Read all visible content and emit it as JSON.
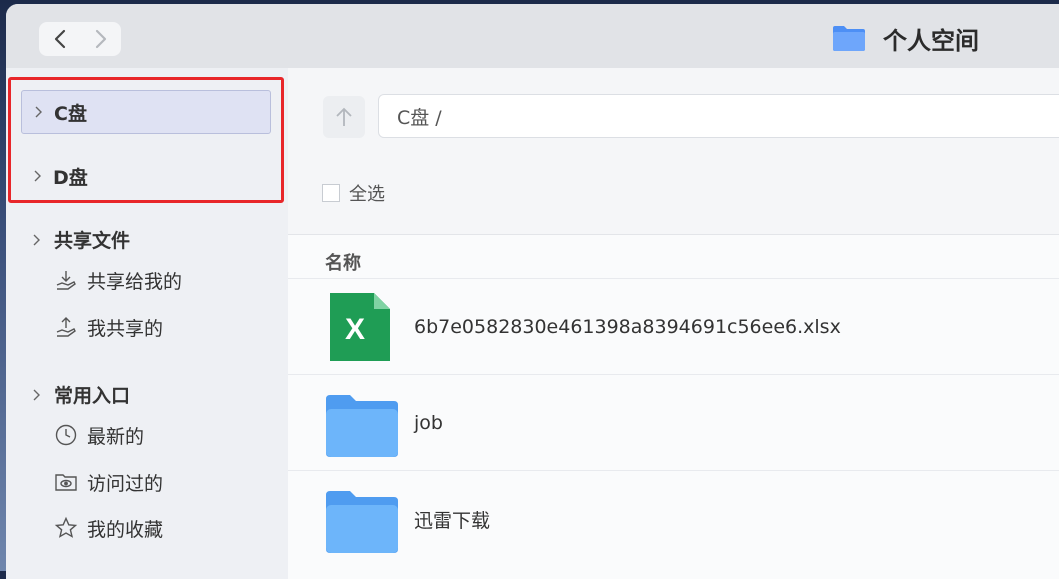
{
  "window": {
    "title": "个人空间"
  },
  "nav": {
    "back_icon": "chevron-left-icon",
    "forward_icon": "chevron-right-icon"
  },
  "sidebar": {
    "drives": [
      {
        "label": "C盘",
        "selected": true
      },
      {
        "label": "D盘",
        "selected": false
      }
    ],
    "shared": {
      "label": "共享文件",
      "items": [
        {
          "label": "共享给我的",
          "icon": "download-hand-icon"
        },
        {
          "label": "我共享的",
          "icon": "upload-hand-icon"
        }
      ]
    },
    "common": {
      "label": "常用入口",
      "items": [
        {
          "label": "最新的",
          "icon": "clock-icon"
        },
        {
          "label": "访问过的",
          "icon": "eye-folder-icon"
        },
        {
          "label": "我的收藏",
          "icon": "star-icon"
        }
      ]
    }
  },
  "main": {
    "path": "C盘 /",
    "select_all": "全选",
    "column_name": "名称",
    "files": [
      {
        "name": "6b7e0582830e461398a8394691c56ee6.xlsx",
        "type": "excel"
      },
      {
        "name": "job",
        "type": "folder"
      },
      {
        "name": "迅雷下载",
        "type": "folder"
      }
    ]
  },
  "colors": {
    "highlight_border": "#e8262a",
    "selected_bg": "#dfe2f3",
    "excel_green": "#1f9d55",
    "folder_blue": "#5aaaf5"
  }
}
